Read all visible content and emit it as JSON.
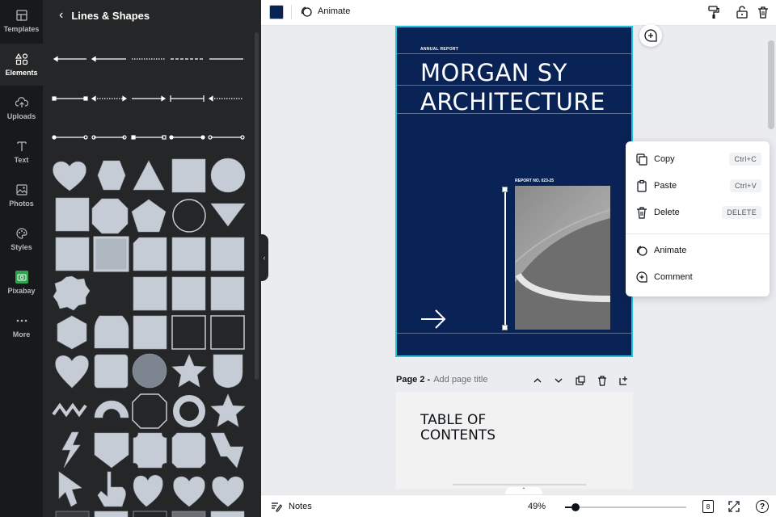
{
  "rail": {
    "items": [
      {
        "label": "Templates",
        "icon": "templates-icon"
      },
      {
        "label": "Elements",
        "icon": "elements-icon"
      },
      {
        "label": "Uploads",
        "icon": "uploads-icon"
      },
      {
        "label": "Text",
        "icon": "text-icon"
      },
      {
        "label": "Photos",
        "icon": "photos-icon"
      },
      {
        "label": "Styles",
        "icon": "styles-icon"
      },
      {
        "label": "Pixabay",
        "icon": "pixabay-icon"
      },
      {
        "label": "More",
        "icon": "more-icon"
      }
    ]
  },
  "panel": {
    "title": "Lines & Shapes"
  },
  "topbar": {
    "animate_label": "Animate",
    "swatch_color": "#0a2356"
  },
  "page1": {
    "eyebrow": "ANNUAL REPORT",
    "title_line1": "MORGAN SY",
    "title_line2": "ARCHITECTURE",
    "report_no": "REPORT NO. 023-25"
  },
  "page2": {
    "label": "Page 2 -",
    "add_title": "Add page title",
    "title_line1": "TABLE OF",
    "title_line2": "CONTENTS"
  },
  "context_menu": {
    "copy": {
      "label": "Copy",
      "shortcut": "Ctrl+C"
    },
    "paste": {
      "label": "Paste",
      "shortcut": "Ctrl+V"
    },
    "delete": {
      "label": "Delete",
      "shortcut": "DELETE"
    },
    "animate": {
      "label": "Animate"
    },
    "comment": {
      "label": "Comment"
    }
  },
  "bottombar": {
    "notes_label": "Notes",
    "zoom": "49%",
    "pages_count": "8",
    "help": "?"
  },
  "colors": {
    "accent": "#21c3d7",
    "page_bg": "#0a2356",
    "shape_fill": "#c5ccd6"
  }
}
